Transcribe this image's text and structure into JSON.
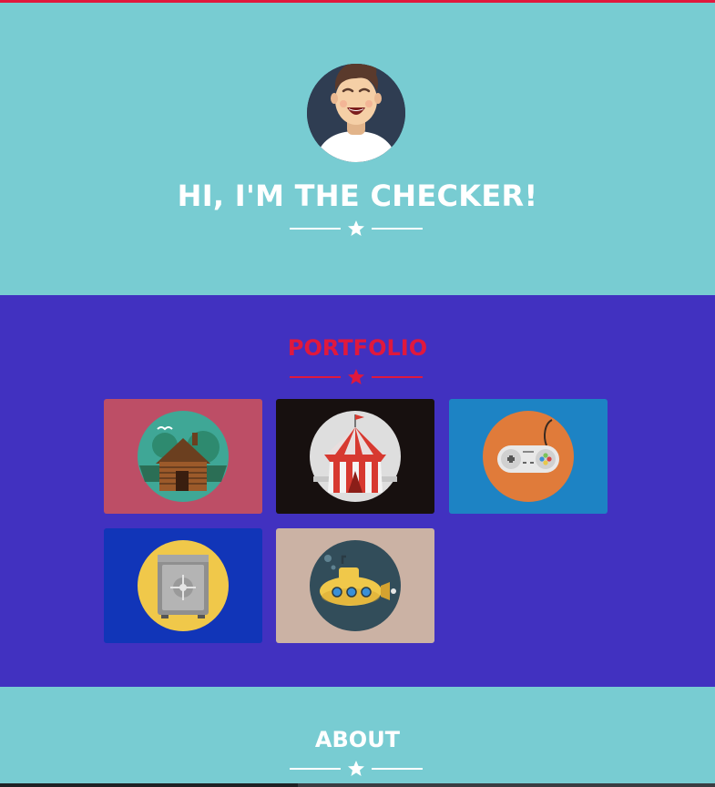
{
  "colors": {
    "teal_bg": "#78ccd2",
    "purple_bg": "#4131c0",
    "accent_red": "#e0183d",
    "white": "#ffffff"
  },
  "hero": {
    "title": "HI, I'M THE CHECKER!",
    "avatar_icon": "laughing-man-avatar",
    "divider_icon": "star-icon"
  },
  "portfolio": {
    "title": "PORTFOLIO",
    "divider_icon": "star-icon",
    "items": [
      {
        "icon": "log-cabin-icon",
        "bg": "#bd4e66"
      },
      {
        "icon": "circus-tent-icon",
        "bg": "#17100f"
      },
      {
        "icon": "game-controller-icon",
        "bg": "#1d83c4"
      },
      {
        "icon": "safe-icon",
        "bg": "#1135b8"
      },
      {
        "icon": "submarine-icon",
        "bg": "#cbb2a4"
      }
    ]
  },
  "about": {
    "title": "ABOUT",
    "divider_icon": "star-icon"
  }
}
